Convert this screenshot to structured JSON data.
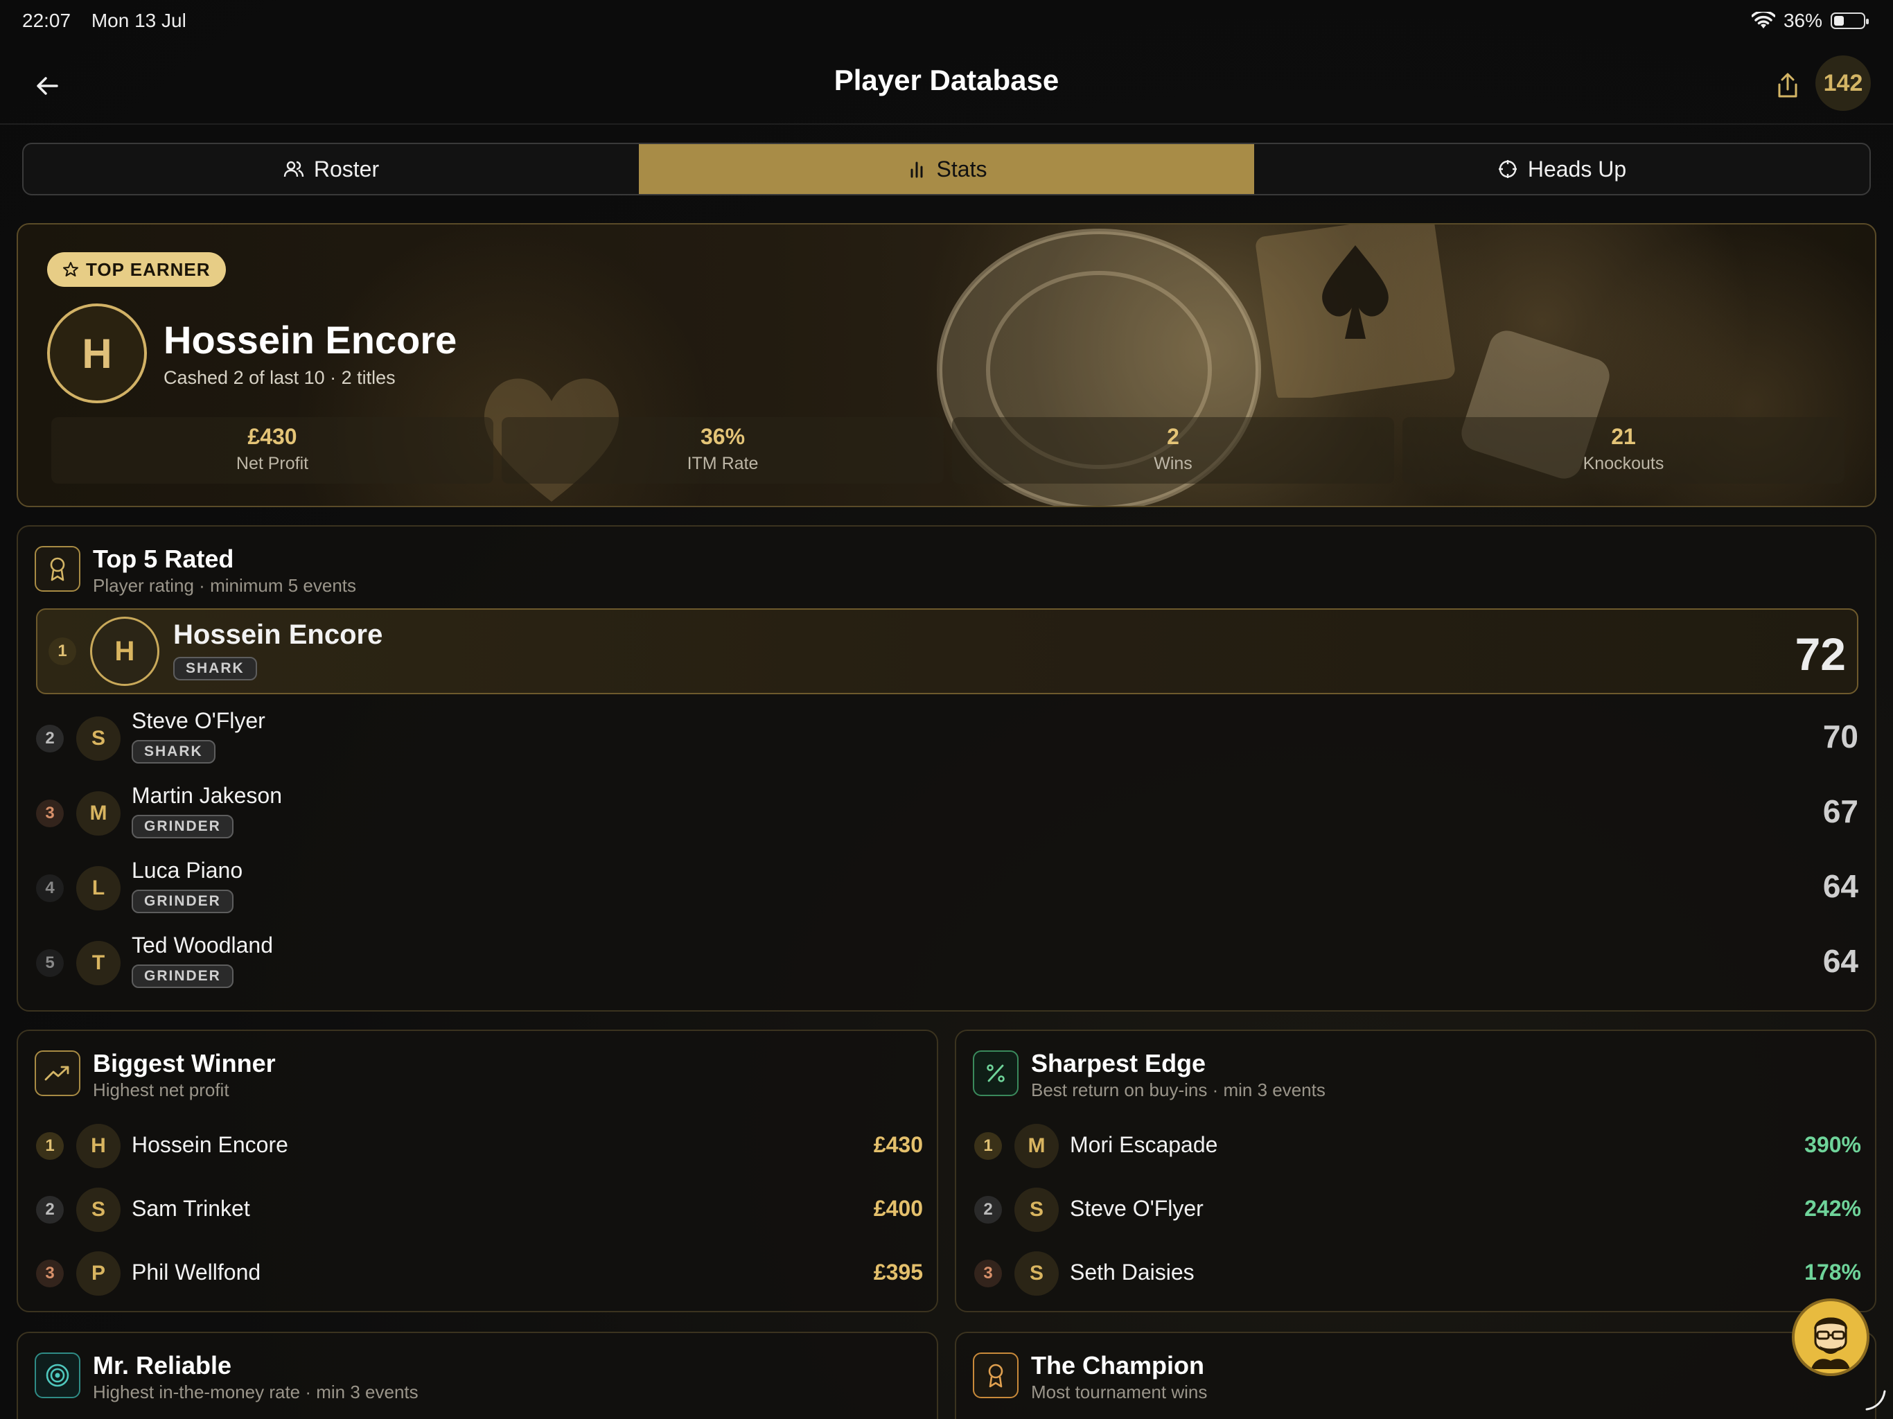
{
  "status": {
    "time": "22:07",
    "date": "Mon 13 Jul",
    "battery": "36%",
    "battery_level": 0.36
  },
  "nav": {
    "title": "Player Database",
    "count": "142"
  },
  "tabs": [
    {
      "label": "Roster",
      "icon": "users-icon"
    },
    {
      "label": "Stats",
      "icon": "bar-chart-icon",
      "active": true
    },
    {
      "label": "Heads Up",
      "icon": "crosshair-icon"
    }
  ],
  "hero": {
    "badge": "TOP EARNER",
    "initial": "H",
    "name": "Hossein Encore",
    "subtitle": "Cashed 2 of last 10 · 2 titles",
    "stats": [
      {
        "value": "£430",
        "label": "Net Profit"
      },
      {
        "value": "36%",
        "label": "ITM Rate"
      },
      {
        "value": "2",
        "label": "Wins"
      },
      {
        "value": "21",
        "label": "Knockouts"
      }
    ]
  },
  "top5": {
    "title": "Top 5 Rated",
    "subtitle": "Player rating · minimum 5 events",
    "rows": [
      {
        "rank": "1",
        "initial": "H",
        "name": "Hossein Encore",
        "tag": "SHARK",
        "score": "72"
      },
      {
        "rank": "2",
        "initial": "S",
        "name": "Steve O'Flyer",
        "tag": "SHARK",
        "score": "70"
      },
      {
        "rank": "3",
        "initial": "M",
        "name": "Martin Jakeson",
        "tag": "GRINDER",
        "score": "67"
      },
      {
        "rank": "4",
        "initial": "L",
        "name": "Luca Piano",
        "tag": "GRINDER",
        "score": "64"
      },
      {
        "rank": "5",
        "initial": "T",
        "name": "Ted Woodland",
        "tag": "GRINDER",
        "score": "64"
      }
    ]
  },
  "biggest_winner": {
    "title": "Biggest Winner",
    "subtitle": "Highest net profit",
    "rows": [
      {
        "rank": "1",
        "initial": "H",
        "name": "Hossein Encore",
        "value": "£430"
      },
      {
        "rank": "2",
        "initial": "S",
        "name": "Sam Trinket",
        "value": "£400"
      },
      {
        "rank": "3",
        "initial": "P",
        "name": "Phil Wellfond",
        "value": "£395"
      }
    ]
  },
  "sharpest_edge": {
    "title": "Sharpest Edge",
    "subtitle": "Best return on buy-ins · min 3 events",
    "rows": [
      {
        "rank": "1",
        "initial": "M",
        "name": "Mori Escapade",
        "value": "390%"
      },
      {
        "rank": "2",
        "initial": "S",
        "name": "Steve O'Flyer",
        "value": "242%"
      },
      {
        "rank": "3",
        "initial": "S",
        "name": "Seth Daisies",
        "value": "178%"
      }
    ]
  },
  "mr_reliable": {
    "title": "Mr. Reliable",
    "subtitle": "Highest in-the-money rate · min 3 events"
  },
  "the_champion": {
    "title": "The Champion",
    "subtitle": "Most tournament wins"
  },
  "colors": {
    "accent": "#a88c47",
    "gold_text": "#e4c06c",
    "green_text": "#6fd49a",
    "background": "#0e0e0e"
  }
}
